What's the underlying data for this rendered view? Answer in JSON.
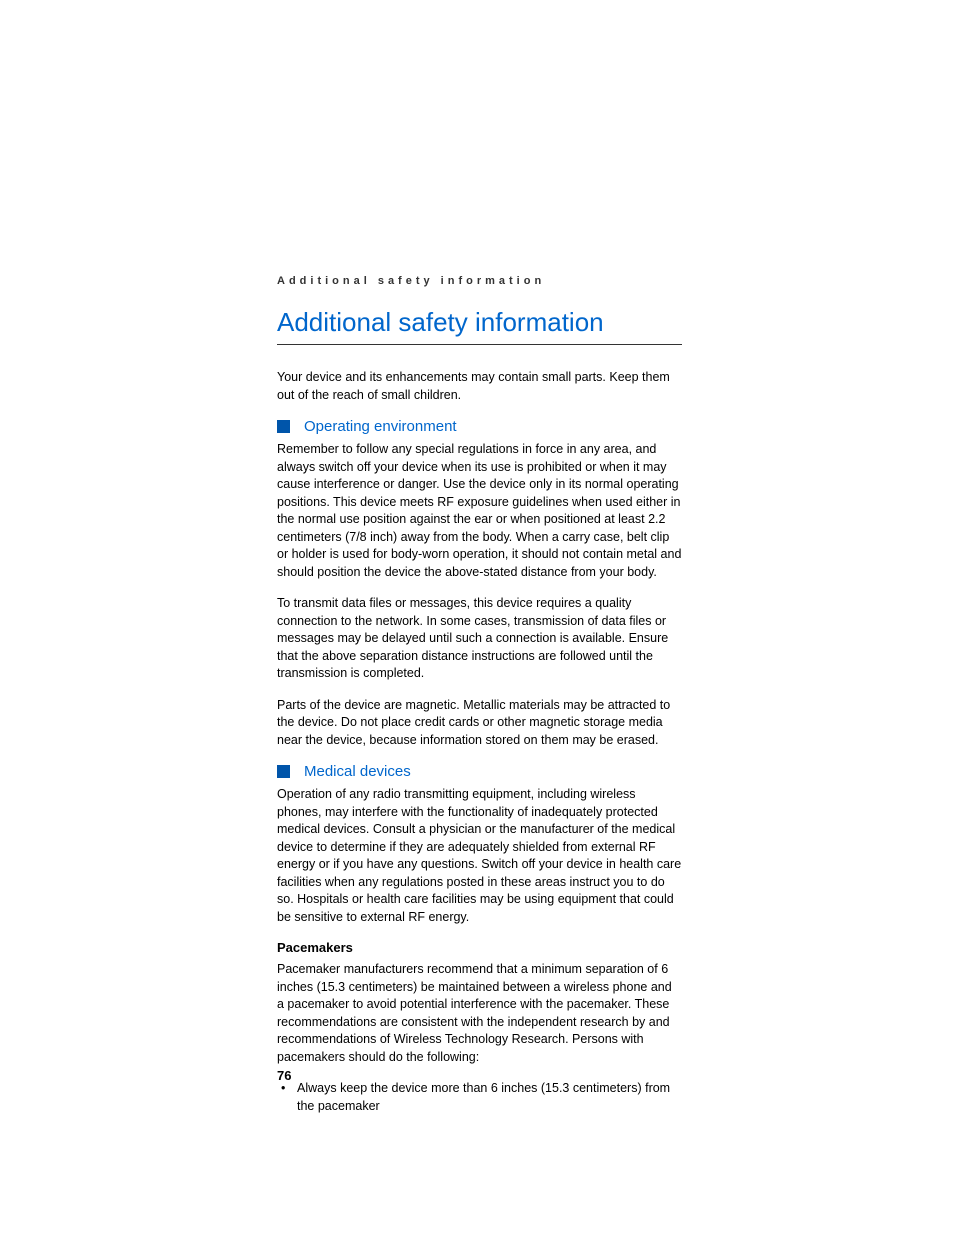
{
  "running_header": "Additional safety information",
  "main_title": "Additional safety information",
  "intro_text": "Your device and its enhancements may contain small parts. Keep them out of the reach of small children.",
  "sections": [
    {
      "title": "Operating environment",
      "paragraphs": [
        "Remember to follow any special regulations in force in any area, and always switch off your device when its use is prohibited or when it may cause interference or danger. Use the device only in its normal operating positions. This device meets RF exposure guidelines when used either in the normal use position against the ear or when positioned at least 2.2 centimeters (7/8 inch) away from the body. When a carry case, belt clip or holder is used for body-worn operation, it should not contain metal and should position the device the above-stated distance from your body.",
        "To transmit data files or messages, this device requires a quality connection to the network. In some cases, transmission of data files or messages may be delayed until such a connection is available. Ensure that the above separation distance instructions are followed until the transmission is completed.",
        "Parts of the device are magnetic. Metallic materials may be attracted to the device. Do not place credit cards or other magnetic storage media near the device, because information stored on them may be erased."
      ]
    },
    {
      "title": "Medical devices",
      "paragraphs": [
        "Operation of any radio transmitting equipment, including wireless phones, may interfere with the functionality of inadequately protected medical devices. Consult a physician or the manufacturer of the medical device to determine if they are adequately shielded from external RF energy or if you have any questions. Switch off your device in health care facilities when any regulations posted in these areas instruct you to do so. Hospitals or health care facilities may be using equipment that could be sensitive to external RF energy."
      ],
      "subsection": {
        "title": "Pacemakers",
        "text": "Pacemaker manufacturers recommend that a minimum separation of 6 inches (15.3 centimeters) be maintained between a wireless phone and a pacemaker to avoid potential interference with the pacemaker. These recommendations are consistent with the independent research by and recommendations of Wireless Technology Research. Persons with pacemakers should do the following:",
        "bullets": [
          "Always keep the device more than 6 inches (15.3 centimeters) from the pacemaker"
        ]
      }
    }
  ],
  "page_number": "76"
}
